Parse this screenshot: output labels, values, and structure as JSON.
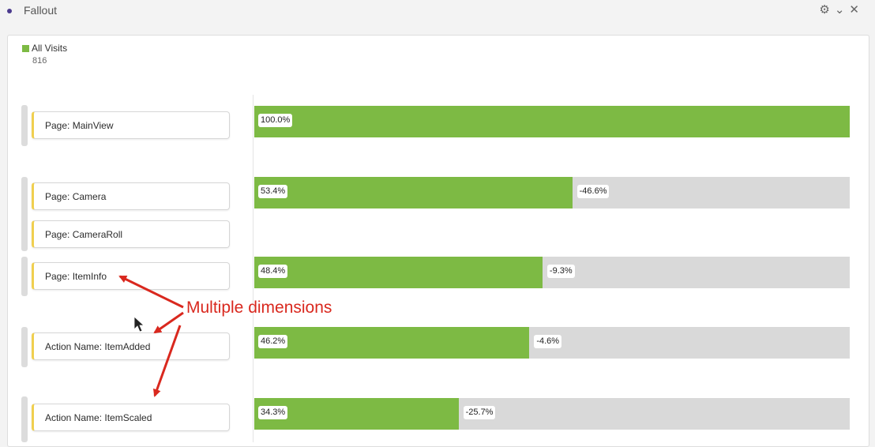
{
  "window": {
    "title": "Fallout",
    "settings_icon": "gear-icon",
    "collapse_icon": "chevron-down-icon",
    "close_icon": "close-icon"
  },
  "legend": {
    "label": "All Visits",
    "total": "816",
    "color": "#7dba44"
  },
  "annotation": {
    "text": "Multiple dimensions",
    "color": "#d9281e"
  },
  "chart_data": {
    "type": "bar",
    "title": "",
    "segment": "All Visits",
    "total": 816,
    "categories": [
      "Page: MainView",
      "Page: Camera",
      "Page: CameraRoll",
      "Page: ItemInfo",
      "Action Name: ItemAdded",
      "Action Name: ItemScaled"
    ],
    "steps": [
      {
        "dimensions": [
          "Page: MainView"
        ],
        "value": 100.0,
        "label": "100.0%",
        "drop": null,
        "drop_label": ""
      },
      {
        "dimensions": [
          "Page: Camera",
          "Page: CameraRoll"
        ],
        "value": 53.4,
        "label": "53.4%",
        "drop": -46.6,
        "drop_label": "-46.6%"
      },
      {
        "dimensions": [
          "Page: ItemInfo"
        ],
        "value": 48.4,
        "label": "48.4%",
        "drop": -9.3,
        "drop_label": "-9.3%"
      },
      {
        "dimensions": [
          "Action Name: ItemAdded"
        ],
        "value": 46.2,
        "label": "46.2%",
        "drop": -4.6,
        "drop_label": "-4.6%"
      },
      {
        "dimensions": [
          "Action Name: ItemScaled"
        ],
        "value": 34.3,
        "label": "34.3%",
        "drop": -25.7,
        "drop_label": "-25.7%"
      }
    ],
    "ylim": [
      0,
      100
    ],
    "colors": {
      "retained": "#7dba44",
      "fallout": "#d9d9d9",
      "dimension_accent": "#f0cf4f"
    }
  }
}
